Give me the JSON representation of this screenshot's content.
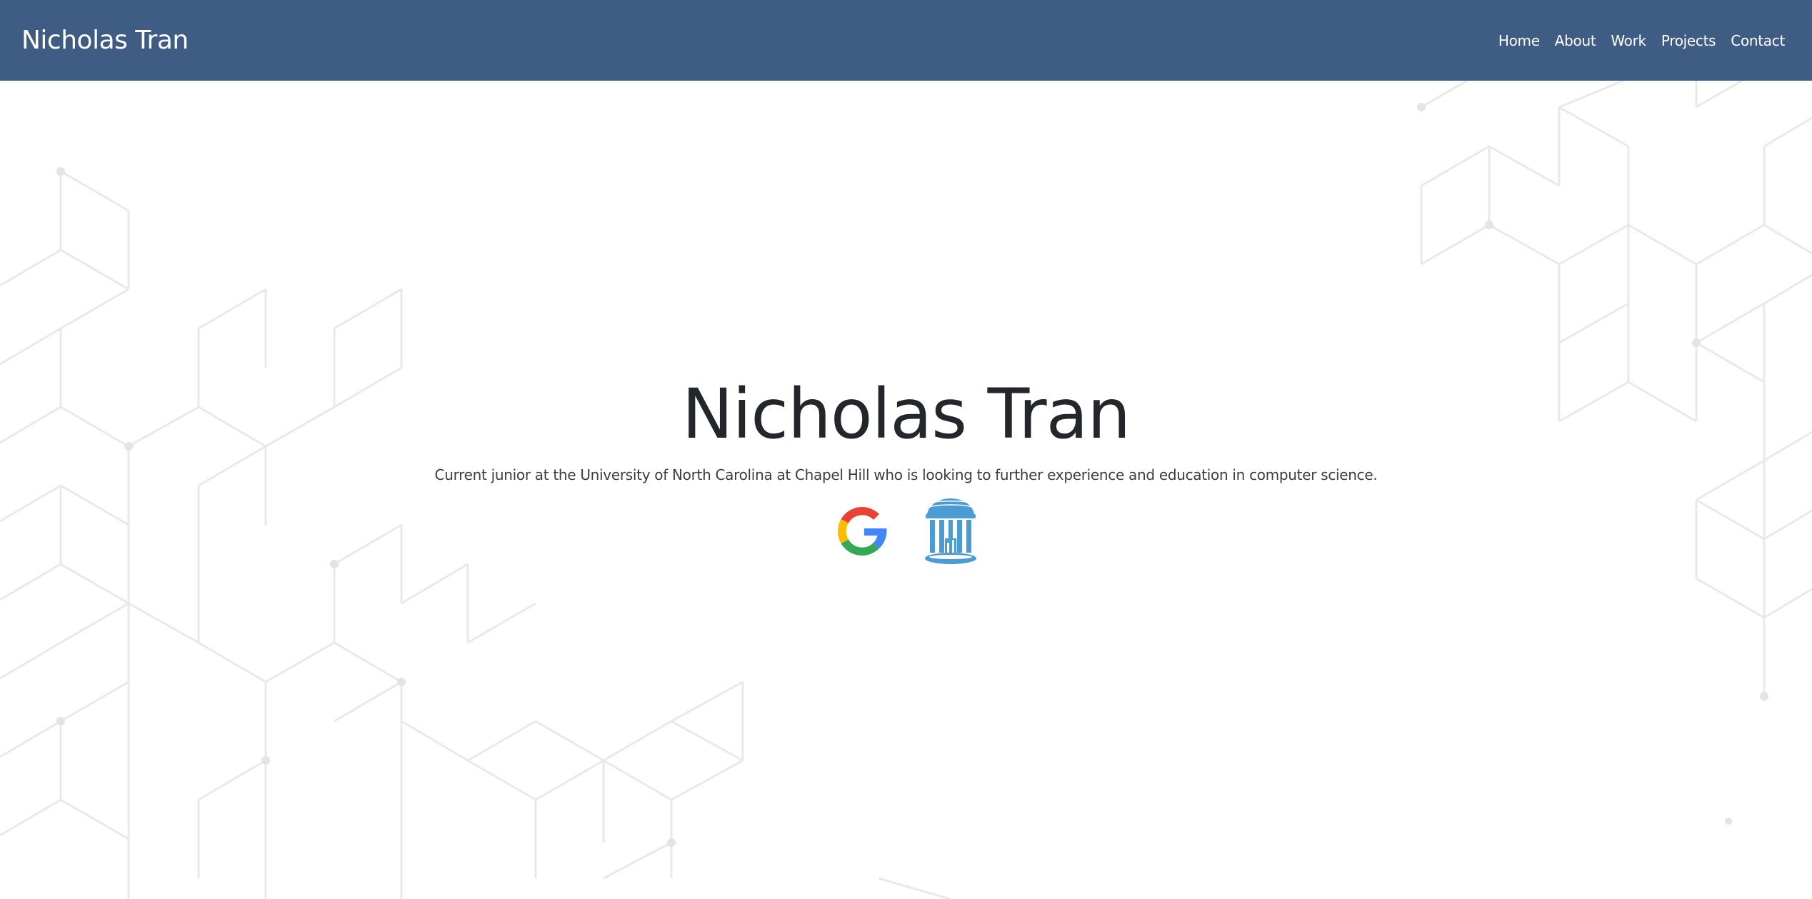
{
  "navbar": {
    "brand": "Nicholas Tran",
    "links": [
      {
        "label": "Home"
      },
      {
        "label": "About"
      },
      {
        "label": "Work"
      },
      {
        "label": "Projects"
      },
      {
        "label": "Contact"
      }
    ]
  },
  "hero": {
    "title": "Nicholas Tran",
    "subtitle": "Current junior at the University of North Carolina at Chapel Hill who is looking to further experience and education in computer science.",
    "logos": [
      {
        "icon": "google-logo-icon"
      },
      {
        "icon": "unc-old-well-icon"
      }
    ]
  },
  "colors": {
    "navbar_bg": "#3e5c84",
    "text_dark": "#23272b",
    "unc_blue": "#4b9cd3"
  }
}
